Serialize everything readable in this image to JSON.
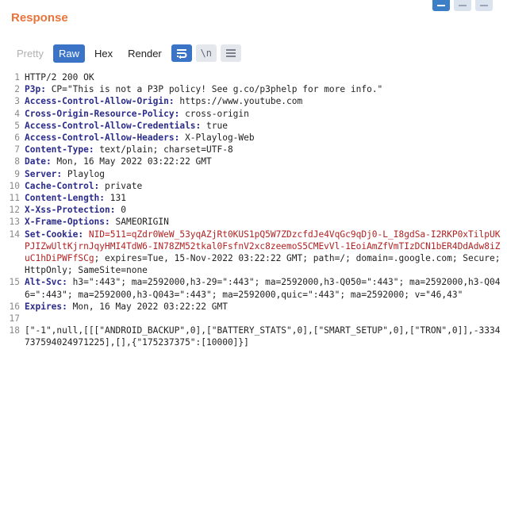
{
  "panel": {
    "title": "Response"
  },
  "toolbar": {
    "pretty": "Pretty",
    "raw": "Raw",
    "hex": "Hex",
    "render": "Render",
    "newline_icon_text": "\\n"
  },
  "lines": [
    {
      "n": "1",
      "segs": [
        {
          "t": "HTTP/2 200 OK",
          "c": ""
        }
      ]
    },
    {
      "n": "2",
      "segs": [
        {
          "t": "P3p:",
          "c": "hk"
        },
        {
          "t": " CP=\"This is not a P3P policy! See g.co/p3phelp for more info.\"",
          "c": ""
        }
      ]
    },
    {
      "n": "3",
      "segs": [
        {
          "t": "Access-Control-Allow-Origin:",
          "c": "hk"
        },
        {
          "t": " https://www.youtube.com",
          "c": ""
        }
      ]
    },
    {
      "n": "4",
      "segs": [
        {
          "t": "Cross-Origin-Resource-Policy:",
          "c": "hk"
        },
        {
          "t": " cross-origin",
          "c": ""
        }
      ]
    },
    {
      "n": "5",
      "segs": [
        {
          "t": "Access-Control-Allow-Credentials:",
          "c": "hk"
        },
        {
          "t": " true",
          "c": ""
        }
      ]
    },
    {
      "n": "6",
      "segs": [
        {
          "t": "Access-Control-Allow-Headers:",
          "c": "hk"
        },
        {
          "t": " X-Playlog-Web",
          "c": ""
        }
      ]
    },
    {
      "n": "7",
      "segs": [
        {
          "t": "Content-Type:",
          "c": "hk"
        },
        {
          "t": " text/plain; charset=UTF-8",
          "c": ""
        }
      ]
    },
    {
      "n": "8",
      "segs": [
        {
          "t": "Date:",
          "c": "hk"
        },
        {
          "t": " Mon, 16 May 2022 03:22:22 GMT",
          "c": ""
        }
      ]
    },
    {
      "n": "9",
      "segs": [
        {
          "t": "Server:",
          "c": "hk"
        },
        {
          "t": " Playlog",
          "c": ""
        }
      ]
    },
    {
      "n": "10",
      "segs": [
        {
          "t": "Cache-Control:",
          "c": "hk"
        },
        {
          "t": " private",
          "c": ""
        }
      ]
    },
    {
      "n": "11",
      "segs": [
        {
          "t": "Content-Length:",
          "c": "hk"
        },
        {
          "t": " 131",
          "c": ""
        }
      ]
    },
    {
      "n": "12",
      "segs": [
        {
          "t": "X-Xss-Protection:",
          "c": "hk"
        },
        {
          "t": " 0",
          "c": ""
        }
      ]
    },
    {
      "n": "13",
      "segs": [
        {
          "t": "X-Frame-Options:",
          "c": "hk"
        },
        {
          "t": " SAMEORIGIN",
          "c": ""
        }
      ]
    },
    {
      "n": "14",
      "segs": [
        {
          "t": "Set-Cookie:",
          "c": "hk"
        },
        {
          "t": " NID=511=qZdr0WeW_53yqAZjRt0KUS1pQ5W7ZDzcfdJe4VqGc9qDj0-L_I8gdSa-I2RKP0xTilpUKPJIZwUltKjrnJqyHMI4TdW6-IN78ZM52tkal0FsfnV2xc8zeemoS5CMEvVl-1EoiAmZfVmTIzDCN1bER4DdAdw8iZuC1hDiPWFfSCg",
          "c": "cv"
        },
        {
          "t": "; expires=Tue, 15-Nov-2022 03:22:22 GMT; path=/; domain=.google.com; Secure; HttpOnly; SameSite=none",
          "c": ""
        }
      ]
    },
    {
      "n": "15",
      "segs": [
        {
          "t": "Alt-Svc:",
          "c": "hk"
        },
        {
          "t": " h3=\":443\"; ma=2592000,h3-29=\":443\"; ma=2592000,h3-Q050=\":443\"; ma=2592000,h3-Q046=\":443\"; ma=2592000,h3-Q043=\":443\"; ma=2592000,quic=\":443\"; ma=2592000; v=\"46,43\"",
          "c": ""
        }
      ]
    },
    {
      "n": "16",
      "segs": [
        {
          "t": "Expires:",
          "c": "hk"
        },
        {
          "t": " Mon, 16 May 2022 03:22:22 GMT",
          "c": ""
        }
      ]
    },
    {
      "n": "17",
      "segs": [
        {
          "t": "",
          "c": ""
        }
      ]
    },
    {
      "n": "18",
      "segs": [
        {
          "t": "[\"-1\",null,[[[\"ANDROID_BACKUP\",0],[\"BATTERY_STATS\",0],[\"SMART_SETUP\",0],[\"TRON\",0]],-3334737594024971225],[],{\"175237375\":[10000]}]",
          "c": ""
        }
      ]
    }
  ]
}
